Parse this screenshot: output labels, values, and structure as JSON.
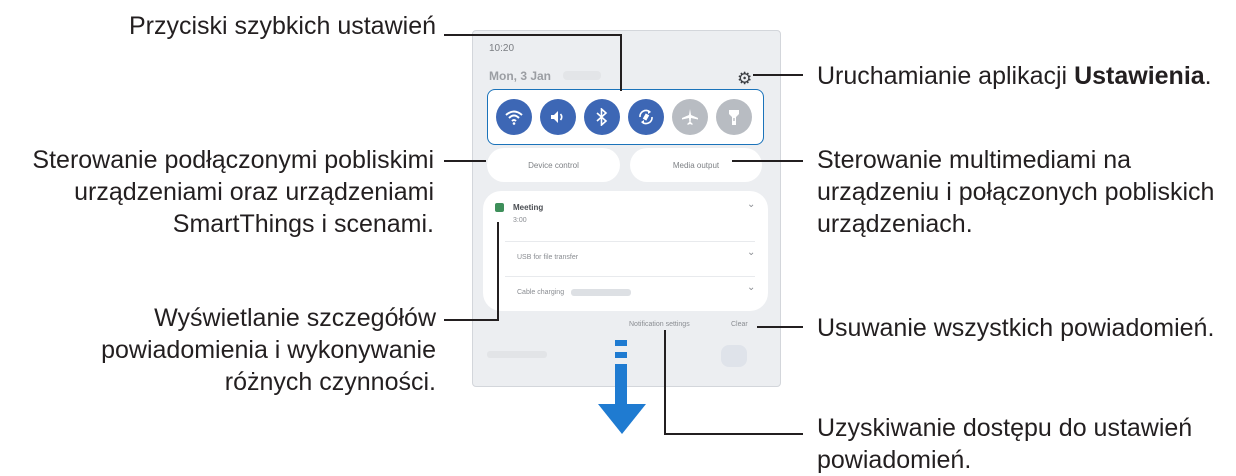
{
  "phone": {
    "time": "10:20",
    "date": "Mon, 3 Jan",
    "device_control_label": "Device control",
    "media_output_label": "Media output",
    "notification_app": "Meeting",
    "notification_sub": "3:00",
    "usb_label": "USB for file transfer",
    "cable_label": "Cable charging",
    "notification_settings_label": "Notification settings",
    "clear_label": "Clear",
    "quick_settings": [
      {
        "name": "wifi",
        "icon": "wifi-icon",
        "glyph": "◠",
        "on": true
      },
      {
        "name": "sound",
        "icon": "sound-icon",
        "glyph": "◀",
        "on": true
      },
      {
        "name": "bluetooth",
        "icon": "bluetooth-icon",
        "glyph": "ᛒ",
        "on": true
      },
      {
        "name": "auto-rotate",
        "icon": "rotate-icon",
        "glyph": "⟳",
        "on": true
      },
      {
        "name": "airplane",
        "icon": "airplane-icon",
        "glyph": "✈",
        "on": false
      },
      {
        "name": "flashlight",
        "icon": "flashlight-icon",
        "glyph": "⚲",
        "on": false
      }
    ]
  },
  "callouts": {
    "quick_settings": "Przyciski szybkich ustawień",
    "settings_prefix": "Uruchamianie aplikacji ",
    "settings_bold": "Ustawienia",
    "settings_suffix": ".",
    "smartthings_1": "Sterowanie podłączonymi pobliskimi",
    "smartthings_2": "urządzeniami oraz urządzeniami",
    "smartthings_3": "SmartThings i scenami.",
    "media_1": "Sterowanie multimediami na",
    "media_2": "urządzeniu i połączonych pobliskich",
    "media_3": "urządzeniach.",
    "details_1": "Wyświetlanie szczegółów",
    "details_2": "powiadomienia i wykonywanie",
    "details_3": "różnych czynności.",
    "clear_all": "Usuwanie wszystkich powiadomień.",
    "notif_settings_1": "Uzyskiwanie dostępu do ustawień",
    "notif_settings_2": "powiadomień."
  },
  "colors": {
    "accent_blue": "#1f7bd1",
    "toggle_on": "#3d67b5",
    "toggle_off": "#b8bcc2",
    "panel_bg": "#eceef1"
  }
}
